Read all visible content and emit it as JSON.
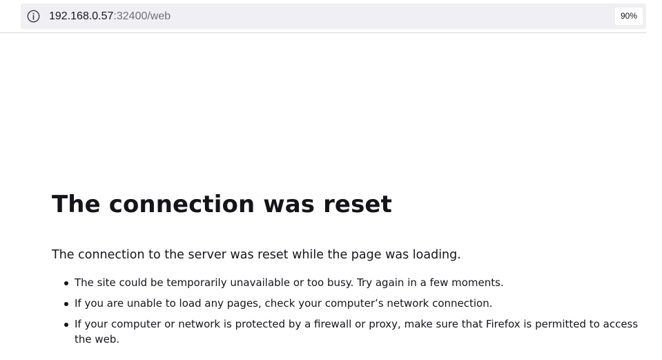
{
  "browser": {
    "url": {
      "host": "192.168.0.57",
      "path": ":32400/web"
    },
    "zoom_level": "90%",
    "site_info_icon": "info-circle-icon"
  },
  "error_page": {
    "title": "The connection was reset",
    "description": "The connection to the server was reset while the page was loading.",
    "suggestions": [
      "The site could be temporarily unavailable or too busy. Try again in a few moments.",
      "If you are unable to load any pages, check your computer’s network connection.",
      "If your computer or network is protected by a firewall or proxy, make sure that Firefox is permitted to access the web."
    ]
  },
  "colors": {
    "text": "#15141a",
    "urlbar_background": "#f0f0f4",
    "url_path": "#6f6f78"
  }
}
